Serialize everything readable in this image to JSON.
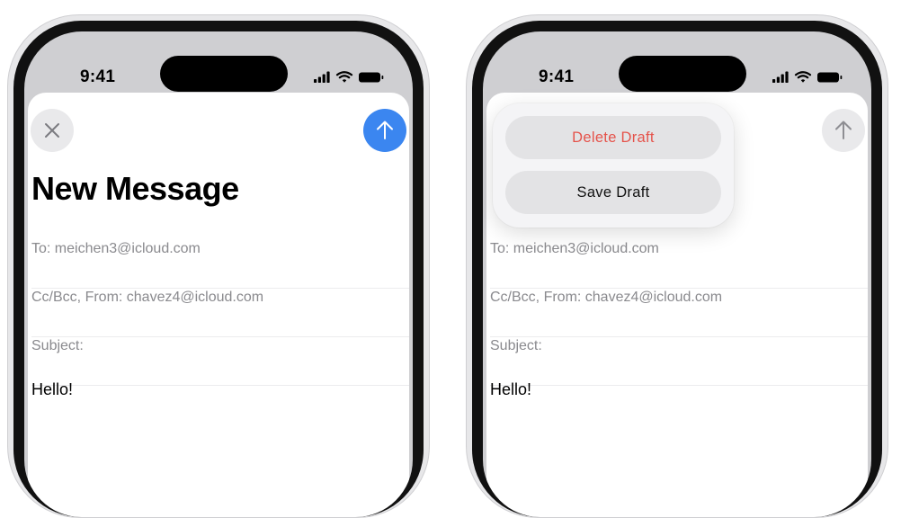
{
  "status_bar": {
    "time": "9:41"
  },
  "left_screen": {
    "title": "New Message",
    "to": "To: meichen3@icloud.com",
    "ccbcc": "Cc/Bcc, From: chavez4@icloud.com",
    "subject": "Subject:",
    "body": "Hello!"
  },
  "right_screen": {
    "menu": {
      "delete_label": "Delete Draft",
      "save_label": "Save Draft"
    },
    "to": "To: meichen3@icloud.com",
    "ccbcc": "Cc/Bcc, From: chavez4@icloud.com",
    "subject": "Subject:",
    "body": "Hello!"
  },
  "colors": {
    "accent": "#3b86f0",
    "destructive": "#e5534b"
  },
  "icons": {
    "close": "xmark-icon",
    "send": "arrow-up-icon"
  }
}
